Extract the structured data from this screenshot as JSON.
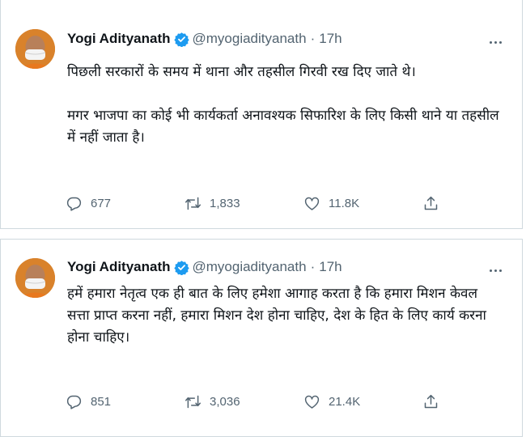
{
  "tweets": [
    {
      "name": "Yogi Adityanath",
      "handle": "@myogiadityanath",
      "separator": "·",
      "time": "17h",
      "text_paragraphs": [
        "पिछली सरकारों के समय में थाना और तहसील गिरवी रख दिए जाते थे।",
        "मगर भाजपा का कोई भी कार्यकर्ता अनावश्यक सिफारिश के लिए किसी थाने या तहसील में नहीं जाता है।"
      ],
      "replies": "677",
      "retweets": "1,833",
      "likes": "11.8K",
      "icons": [
        "verified-badge-icon",
        "more-options-icon",
        "reply-icon",
        "retweet-icon",
        "like-icon",
        "share-icon"
      ]
    },
    {
      "name": "Yogi Adityanath",
      "handle": "@myogiadityanath",
      "separator": "·",
      "time": "17h",
      "text_paragraphs": [
        "हमें हमारा नेतृत्व एक ही बात के लिए हमेशा आगाह करता है कि हमारा मिशन केवल सत्ता प्राप्त करना नहीं, हमारा मिशन देश होना चाहिए, देश के हित के लिए कार्य करना होना चाहिए।"
      ],
      "replies": "851",
      "retweets": "3,036",
      "likes": "21.4K",
      "icons": [
        "verified-badge-icon",
        "more-options-icon",
        "reply-icon",
        "retweet-icon",
        "like-icon",
        "share-icon"
      ]
    }
  ],
  "colors": {
    "verified_blue": "#1d9bf0",
    "secondary_text": "#536471",
    "primary_text": "#0f1419",
    "divider": "#cfd9de",
    "avatar_saffron": "#d9822b"
  }
}
